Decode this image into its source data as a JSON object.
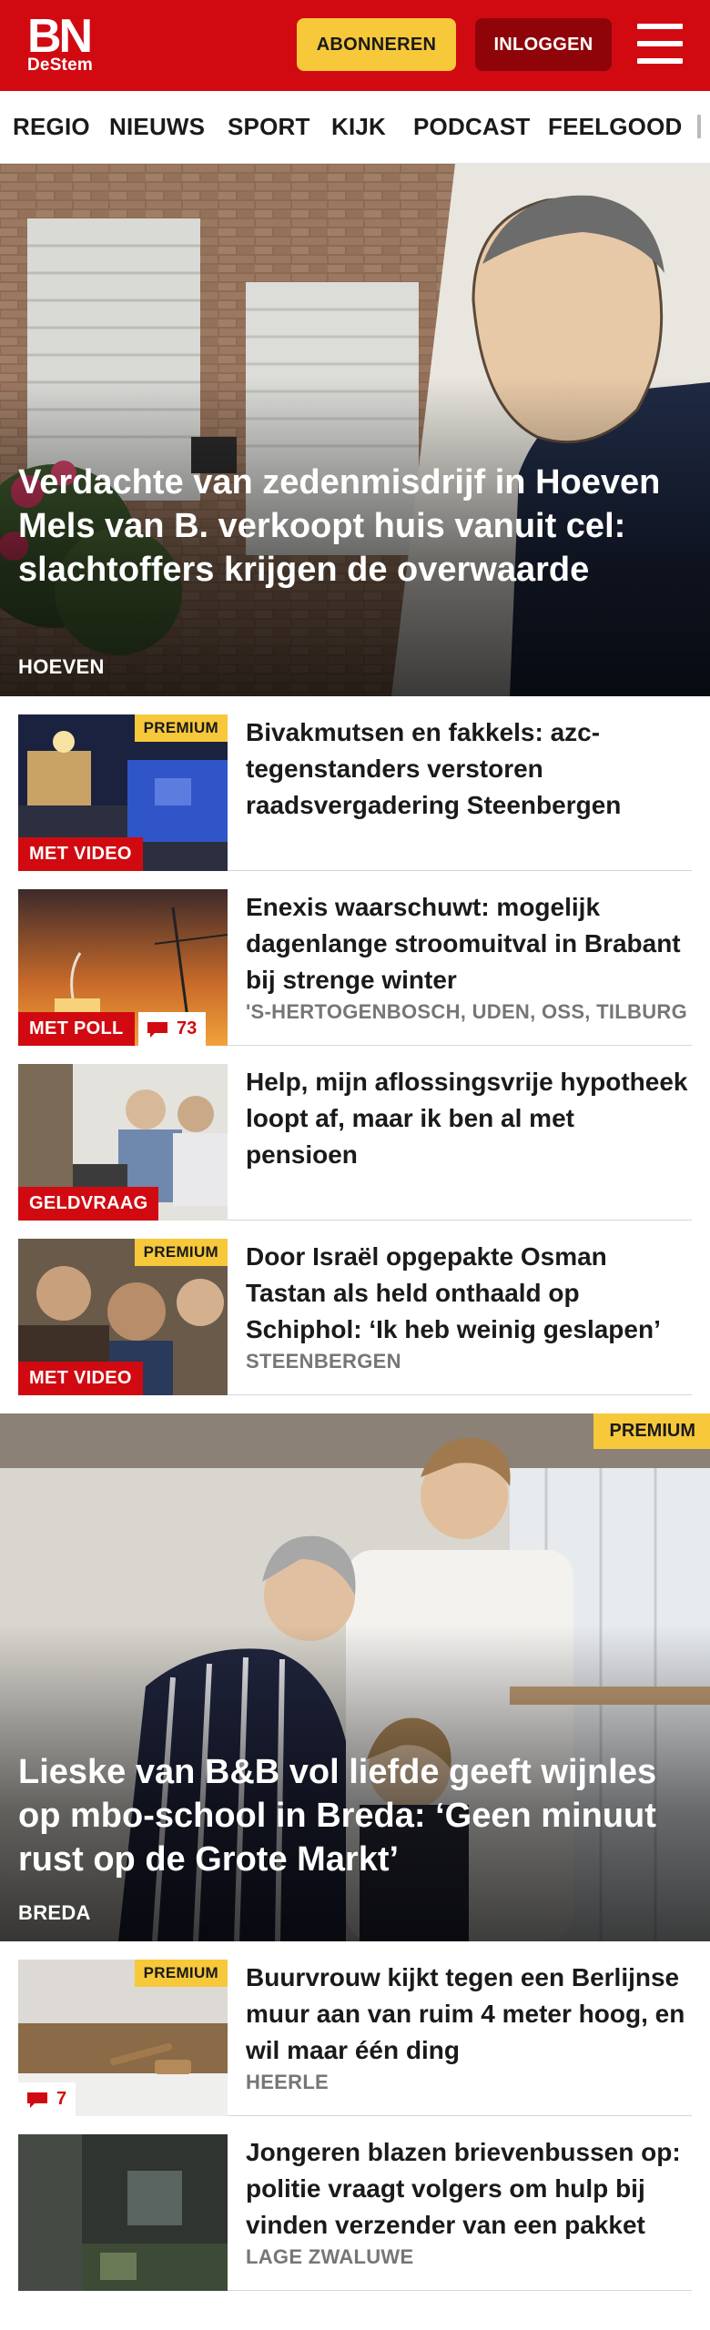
{
  "header": {
    "logo_main": "BN",
    "logo_sub": "DeStem",
    "subscribe_label": "ABONNEREN",
    "login_label": "INLOGGEN",
    "brand_color": "#d10a11",
    "accent_color": "#f7c83a"
  },
  "nav": {
    "items": [
      "REGIO",
      "NIEUWS",
      "SPORT",
      "KIJK",
      "PODCAST",
      "FEELGOOD"
    ]
  },
  "hero1": {
    "title": "Verdachte van zedenmisdrijf in Hoeven Mels van B. verkoopt huis vanuit cel: slachtoffers krijgen de overwaarde",
    "location": "HOEVEN"
  },
  "articles": [
    {
      "title": "Bivakmutsen en fakkels: azc-tegenstanders verstoren raadsvergadering Steenbergen",
      "location": "",
      "premium": "PREMIUM",
      "tag": "MET VIDEO"
    },
    {
      "title": "Enexis waarschuwt: mogelijk dagenlange stroomuitval in Brabant bij strenge winter",
      "location": "'S-HERTOGENBOSCH, UDEN, OSS, TILBURG",
      "tag": "MET POLL",
      "comments": "73"
    },
    {
      "title": "Help, mijn aflossingsvrije hypotheek loopt af, maar ik ben al met pensioen",
      "location": "",
      "tag": "GELDVRAAG"
    },
    {
      "title": "Door Israël opgepakte Osman Tastan als held onthaald op Schiphol: ‘Ik heb weinig geslapen’",
      "location": "STEENBERGEN",
      "premium": "PREMIUM",
      "tag": "MET VIDEO"
    }
  ],
  "hero2": {
    "title": "Lieske van B&B vol liefde geeft wijnles op mbo-school in Breda: ‘Geen minuut rust op de Grote Markt’",
    "location": "BREDA",
    "premium": "PREMIUM"
  },
  "articles2": [
    {
      "title": "Buurvrouw kijkt tegen een Berlijnse muur aan van ruim 4 meter hoog, en wil maar één ding",
      "location": "HEERLE",
      "premium": "PREMIUM",
      "comments": "7"
    },
    {
      "title": "Jongeren blazen brievenbussen op: politie vraagt volgers om hulp bij vinden verzender van een pakket",
      "location": "LAGE ZWALUWE"
    }
  ]
}
